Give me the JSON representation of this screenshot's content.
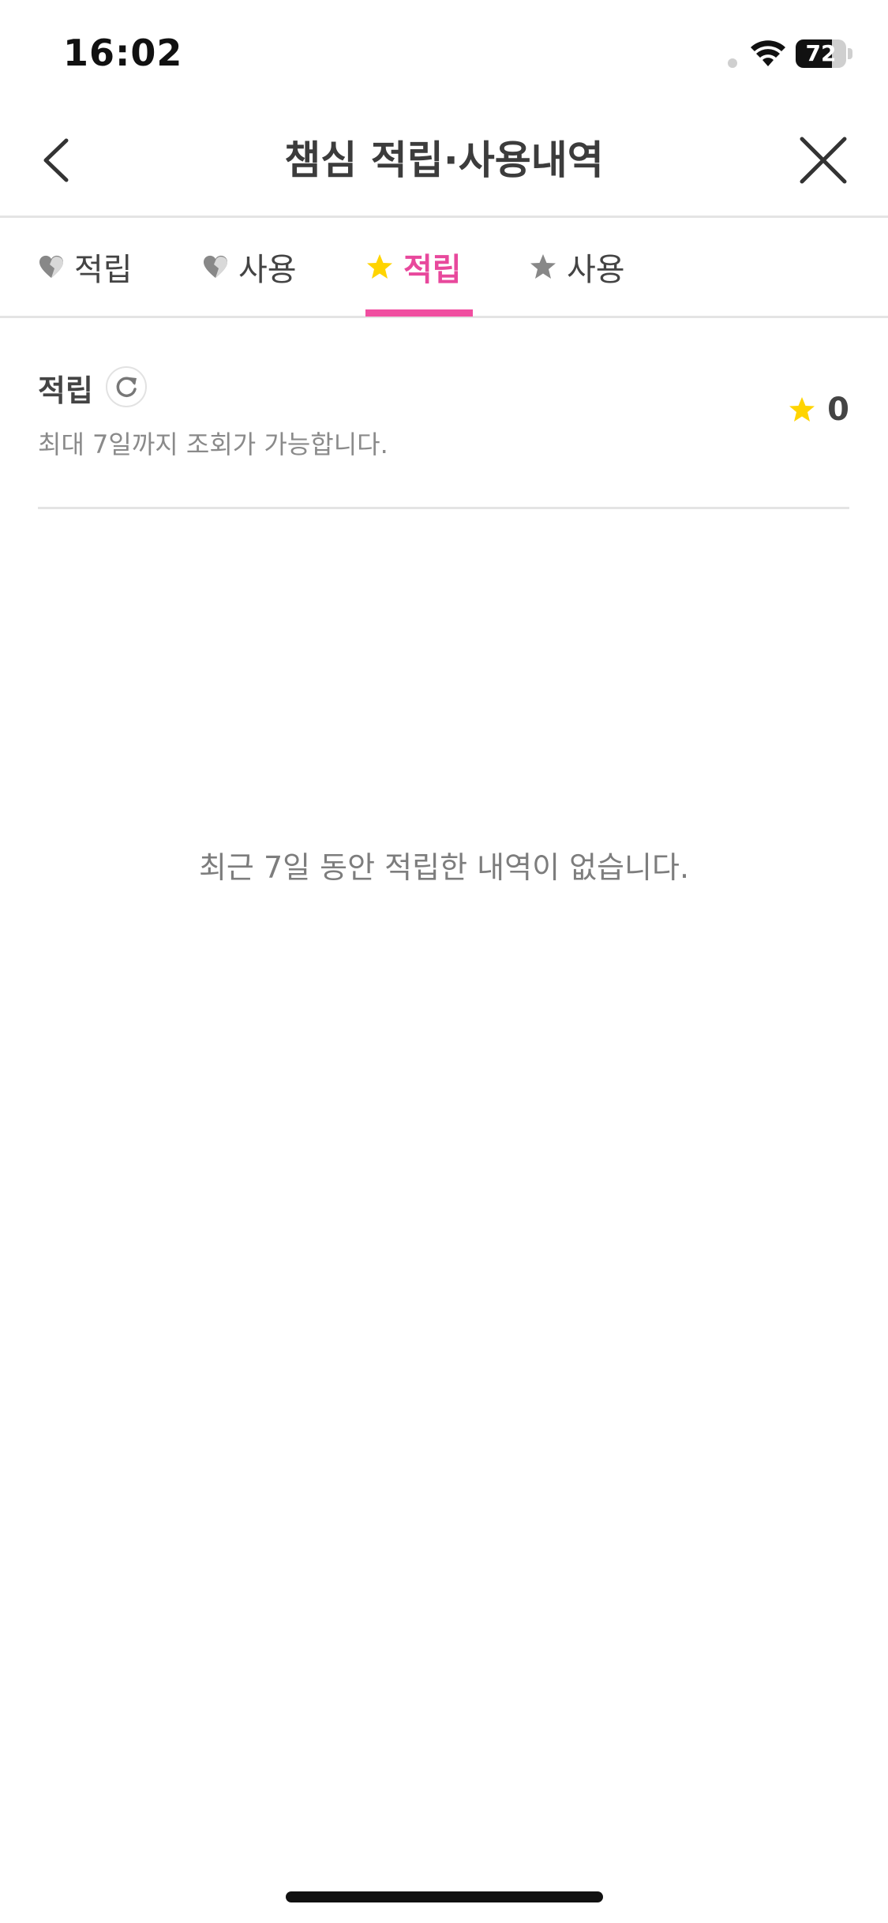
{
  "status_bar": {
    "time": "16:02",
    "battery_level": "72",
    "battery_fraction": 0.72
  },
  "nav": {
    "title": "챔심 적립·사용내역",
    "back_icon": "chevron-left-icon",
    "close_icon": "close-icon"
  },
  "tabs": [
    {
      "label": "적립",
      "icon": "heart-icon",
      "active": false
    },
    {
      "label": "사용",
      "icon": "heart-icon",
      "active": false
    },
    {
      "label": "적립",
      "icon": "star-icon",
      "active": true
    },
    {
      "label": "사용",
      "icon": "star-icon",
      "active": false
    }
  ],
  "summary": {
    "title": "적립",
    "description": "최대 7일까지 조회가 가능합니다.",
    "count": "0"
  },
  "empty_message": "최근 7일 동안 적립한 내역이 없습니다.",
  "colors": {
    "accent": "#f04ea0",
    "star": "#ffd400",
    "icon_gray": "#888888"
  }
}
